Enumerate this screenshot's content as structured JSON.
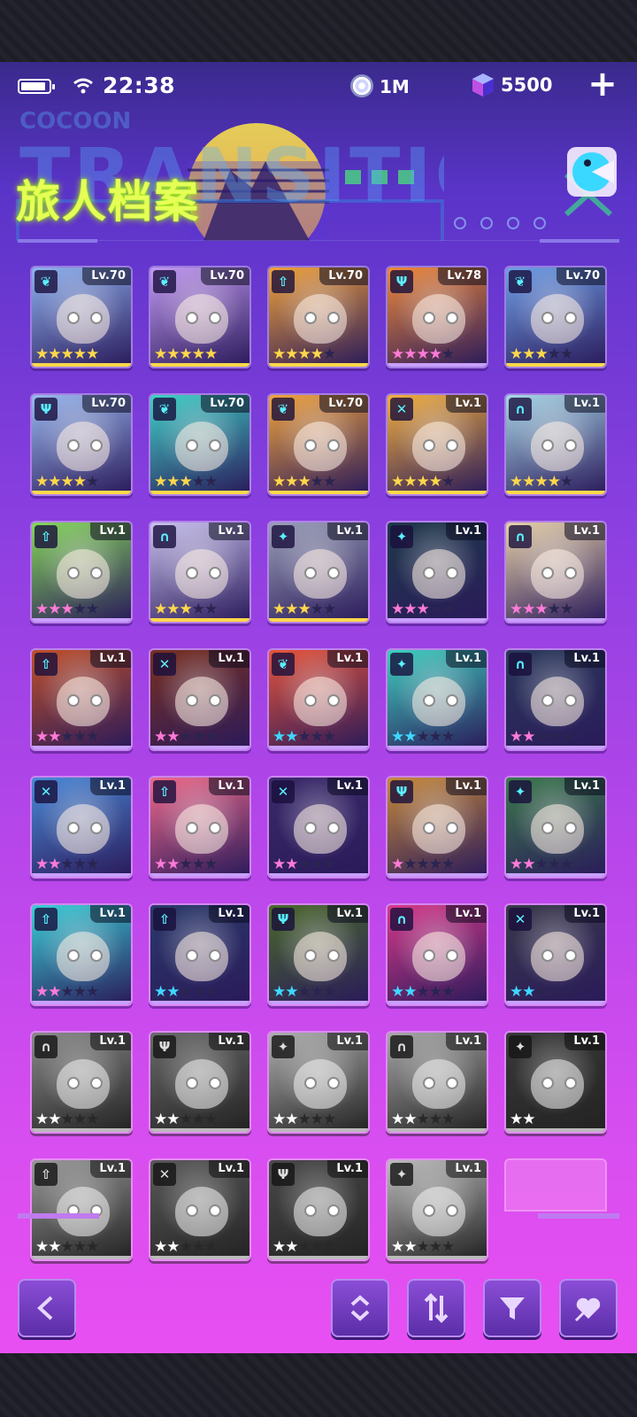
{
  "status": {
    "time": "22:38",
    "battery_level": 0.9,
    "wifi_icon": "wifi-icon"
  },
  "currency": {
    "coins": "1M",
    "gems": "5500"
  },
  "banner": {
    "title": "旅人档案",
    "bg_text_line1": "COCOON",
    "bg_text_line2": "TRANSITION"
  },
  "roster": [
    {
      "level": "Lv.70",
      "class_icon": "leaf-icon",
      "stars_filled": 5,
      "star_color": "#ffd84a",
      "color": "#8fb2f0",
      "active": true
    },
    {
      "level": "Lv.70",
      "class_icon": "leaf-icon",
      "stars_filled": 5,
      "star_color": "#ffd84a",
      "color": "#c39af2",
      "active": true
    },
    {
      "level": "Lv.70",
      "class_icon": "arrow-up-icon",
      "stars_filled": 4,
      "star_color": "#ffd84a",
      "color": "#f2a23a",
      "active": true
    },
    {
      "level": "Lv.78",
      "class_icon": "shield-icon",
      "stars_filled": 4,
      "star_color": "#ff7ad8",
      "color": "#f08a3a",
      "active": true
    },
    {
      "level": "Lv.70",
      "class_icon": "leaf-icon",
      "stars_filled": 3,
      "star_color": "#ffd84a",
      "color": "#6fa0e8",
      "active": true
    },
    {
      "level": "Lv.70",
      "class_icon": "shield-icon",
      "stars_filled": 4,
      "star_color": "#ffd84a",
      "color": "#9ab9f0",
      "active": true
    },
    {
      "level": "Lv.70",
      "class_icon": "leaf-icon",
      "stars_filled": 3,
      "star_color": "#ffd84a",
      "color": "#3fd2c8",
      "active": true
    },
    {
      "level": "Lv.70",
      "class_icon": "leaf-icon",
      "stars_filled": 3,
      "star_color": "#ffd84a",
      "color": "#f3a43c",
      "active": true
    },
    {
      "level": "Lv.1",
      "class_icon": "swords-icon",
      "stars_filled": 4,
      "star_color": "#ffd84a",
      "color": "#f4b03e",
      "active": true
    },
    {
      "level": "Lv.1",
      "class_icon": "arch-icon",
      "stars_filled": 4,
      "star_color": "#ffd84a",
      "color": "#a8d8e8",
      "active": true
    },
    {
      "level": "Lv.1",
      "class_icon": "arrow-up-icon",
      "stars_filled": 3,
      "star_color": "#ff7ad8",
      "color": "#86d85a",
      "active": true
    },
    {
      "level": "Lv.1",
      "class_icon": "arch-icon",
      "stars_filled": 3,
      "star_color": "#ffd84a",
      "color": "#c9c2ee",
      "active": true
    },
    {
      "level": "Lv.1",
      "class_icon": "bow-icon",
      "stars_filled": 3,
      "star_color": "#ffd84a",
      "color": "#9aa0b8",
      "active": true
    },
    {
      "level": "Lv.1",
      "class_icon": "bow-icon",
      "stars_filled": 3,
      "star_color": "#ff7ad8",
      "color": "#1e3a4a",
      "active": true
    },
    {
      "level": "Lv.1",
      "class_icon": "arch-icon",
      "stars_filled": 3,
      "star_color": "#ff7ad8",
      "color": "#e8d2a8",
      "active": true
    },
    {
      "level": "Lv.1",
      "class_icon": "arrow-up-icon",
      "stars_filled": 2,
      "star_color": "#ff7ad8",
      "color": "#c0502a",
      "active": true
    },
    {
      "level": "Lv.1",
      "class_icon": "swords-icon",
      "stars_filled": 2,
      "star_color": "#ff7ad8",
      "color": "#7a3020",
      "active": true
    },
    {
      "level": "Lv.1",
      "class_icon": "leaf-icon",
      "stars_filled": 2,
      "star_color": "#3fd8ff",
      "color": "#e8543a",
      "active": true
    },
    {
      "level": "Lv.1",
      "class_icon": "bow-icon",
      "stars_filled": 2,
      "star_color": "#3fd8ff",
      "color": "#3ed0c0",
      "active": true
    },
    {
      "level": "Lv.1",
      "class_icon": "arch-icon",
      "stars_filled": 2,
      "star_color": "#ff7ad8",
      "color": "#2a3a5a",
      "active": true
    },
    {
      "level": "Lv.1",
      "class_icon": "swords-icon",
      "stars_filled": 2,
      "star_color": "#ff7ad8",
      "color": "#4a8ad8",
      "active": true
    },
    {
      "level": "Lv.1",
      "class_icon": "arrow-up-icon",
      "stars_filled": 2,
      "star_color": "#ff7ad8",
      "color": "#f06a8a",
      "active": true
    },
    {
      "level": "Lv.1",
      "class_icon": "swords-icon",
      "stars_filled": 2,
      "star_color": "#ff7ad8",
      "color": "#3a2a6a",
      "active": true
    },
    {
      "level": "Lv.1",
      "class_icon": "shield-icon",
      "stars_filled": 1,
      "star_color": "#ff7ad8",
      "color": "#c88a3a",
      "active": true
    },
    {
      "level": "Lv.1",
      "class_icon": "bow-icon",
      "stars_filled": 2,
      "star_color": "#ff7ad8",
      "color": "#3a7a4a",
      "active": true
    },
    {
      "level": "Lv.1",
      "class_icon": "arrow-up-icon",
      "stars_filled": 2,
      "star_color": "#ff7ad8",
      "color": "#3ad0d8",
      "active": true
    },
    {
      "level": "Lv.1",
      "class_icon": "arrow-up-icon",
      "stars_filled": 2,
      "star_color": "#3fd8ff",
      "color": "#2a3a6a",
      "active": true
    },
    {
      "level": "Lv.1",
      "class_icon": "shield-icon",
      "stars_filled": 2,
      "star_color": "#3fd8ff",
      "color": "#4a6a2a",
      "active": true
    },
    {
      "level": "Lv.1",
      "class_icon": "arch-icon",
      "stars_filled": 2,
      "star_color": "#3fd8ff",
      "color": "#d83a8a",
      "active": true
    },
    {
      "level": "Lv.1",
      "class_icon": "swords-icon",
      "stars_filled": 2,
      "star_color": "#3fd8ff",
      "color": "#3a3a4a",
      "active": true
    },
    {
      "level": "Lv.1",
      "class_icon": "arch-icon",
      "stars_filled": 2,
      "star_color": "#ffffff",
      "color": "#8a8a8a",
      "active": false
    },
    {
      "level": "Lv.1",
      "class_icon": "shield-icon",
      "stars_filled": 2,
      "star_color": "#ffffff",
      "color": "#6a6a6a",
      "active": false
    },
    {
      "level": "Lv.1",
      "class_icon": "bow-icon",
      "stars_filled": 2,
      "star_color": "#ffffff",
      "color": "#b0b0b0",
      "active": false
    },
    {
      "level": "Lv.1",
      "class_icon": "arch-icon",
      "stars_filled": 2,
      "star_color": "#ffffff",
      "color": "#a8a8a8",
      "active": false
    },
    {
      "level": "Lv.1",
      "class_icon": "bow-icon",
      "stars_filled": 2,
      "star_color": "#ffffff",
      "color": "#3a3a3a",
      "active": false
    },
    {
      "level": "Lv.1",
      "class_icon": "arrow-up-icon",
      "stars_filled": 2,
      "star_color": "#ffffff",
      "color": "#9a9a9a",
      "active": false
    },
    {
      "level": "Lv.1",
      "class_icon": "swords-icon",
      "stars_filled": 2,
      "star_color": "#ffffff",
      "color": "#5a5a5a",
      "active": false
    },
    {
      "level": "Lv.1",
      "class_icon": "shield-icon",
      "stars_filled": 2,
      "star_color": "#ffffff",
      "color": "#4a4a4a",
      "active": false
    },
    {
      "level": "Lv.1",
      "class_icon": "bow-icon",
      "stars_filled": 2,
      "star_color": "#ffffff",
      "color": "#bdbdbd",
      "active": false
    }
  ],
  "toolbar": {
    "back": "back-arrow-icon",
    "sort_order": "sort-updown-icon",
    "sort_swap": "swap-arrows-icon",
    "filter": "filter-funnel-icon",
    "favorite": "heart-pin-icon"
  }
}
